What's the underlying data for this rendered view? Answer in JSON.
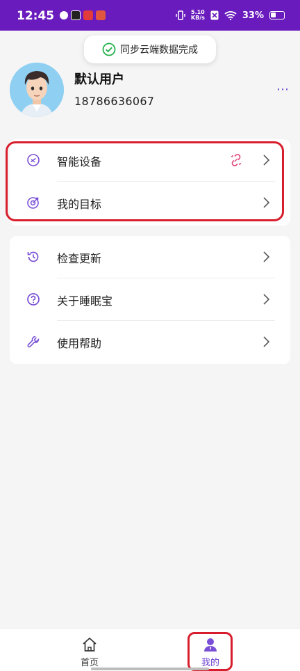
{
  "status_bar": {
    "time": "12:45",
    "net_speed_value": "5.10",
    "net_speed_unit": "KB/s",
    "battery": "33%"
  },
  "toast": {
    "message": "同步云端数据完成",
    "icon": "check-circle-icon",
    "color": "#22b14c"
  },
  "profile": {
    "username": "默认用户",
    "phone": "18786636067",
    "more_icon": "more-dots-icon"
  },
  "menu_group_1": [
    {
      "label": "智能设备",
      "icon": "device-icon",
      "status_icon": "unlink-icon"
    },
    {
      "label": "我的目标",
      "icon": "target-icon"
    }
  ],
  "menu_group_2": [
    {
      "label": "检查更新",
      "icon": "history-icon"
    },
    {
      "label": "关于睡眠宝",
      "icon": "help-circle-icon"
    },
    {
      "label": "使用帮助",
      "icon": "wrench-icon"
    }
  ],
  "tab_bar": {
    "home_label": "首页",
    "mine_label": "我的",
    "active_tab": "mine"
  },
  "colors": {
    "status_bar": "#6a1bbd",
    "accent": "#6a3fd1",
    "unlink": "#e0457b",
    "highlight": "#d81e2c"
  }
}
